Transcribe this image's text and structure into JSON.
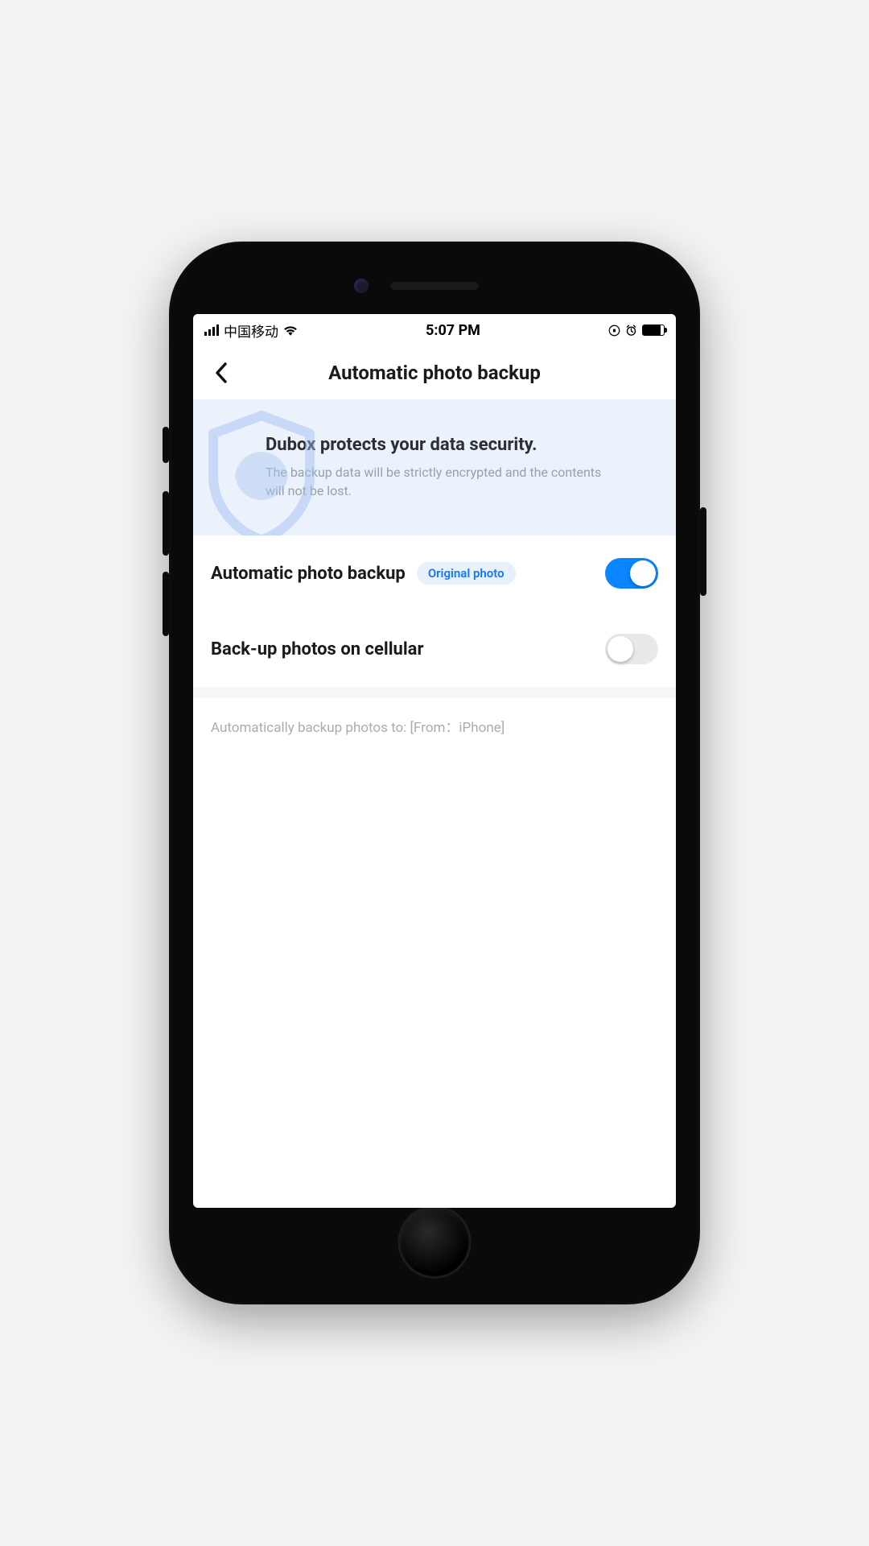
{
  "status_bar": {
    "carrier": "中国移动",
    "time": "5:07 PM"
  },
  "header": {
    "title": "Automatic photo backup"
  },
  "banner": {
    "title": "Dubox protects your data security.",
    "subtitle": "The backup data will be strictly encrypted and the contents will not be lost."
  },
  "settings": {
    "auto_backup": {
      "label": "Automatic photo backup",
      "badge": "Original photo",
      "enabled": true
    },
    "cellular_backup": {
      "label": "Back-up photos on cellular",
      "enabled": false
    }
  },
  "footer": {
    "text": "Automatically backup photos to: [From：iPhone]"
  }
}
